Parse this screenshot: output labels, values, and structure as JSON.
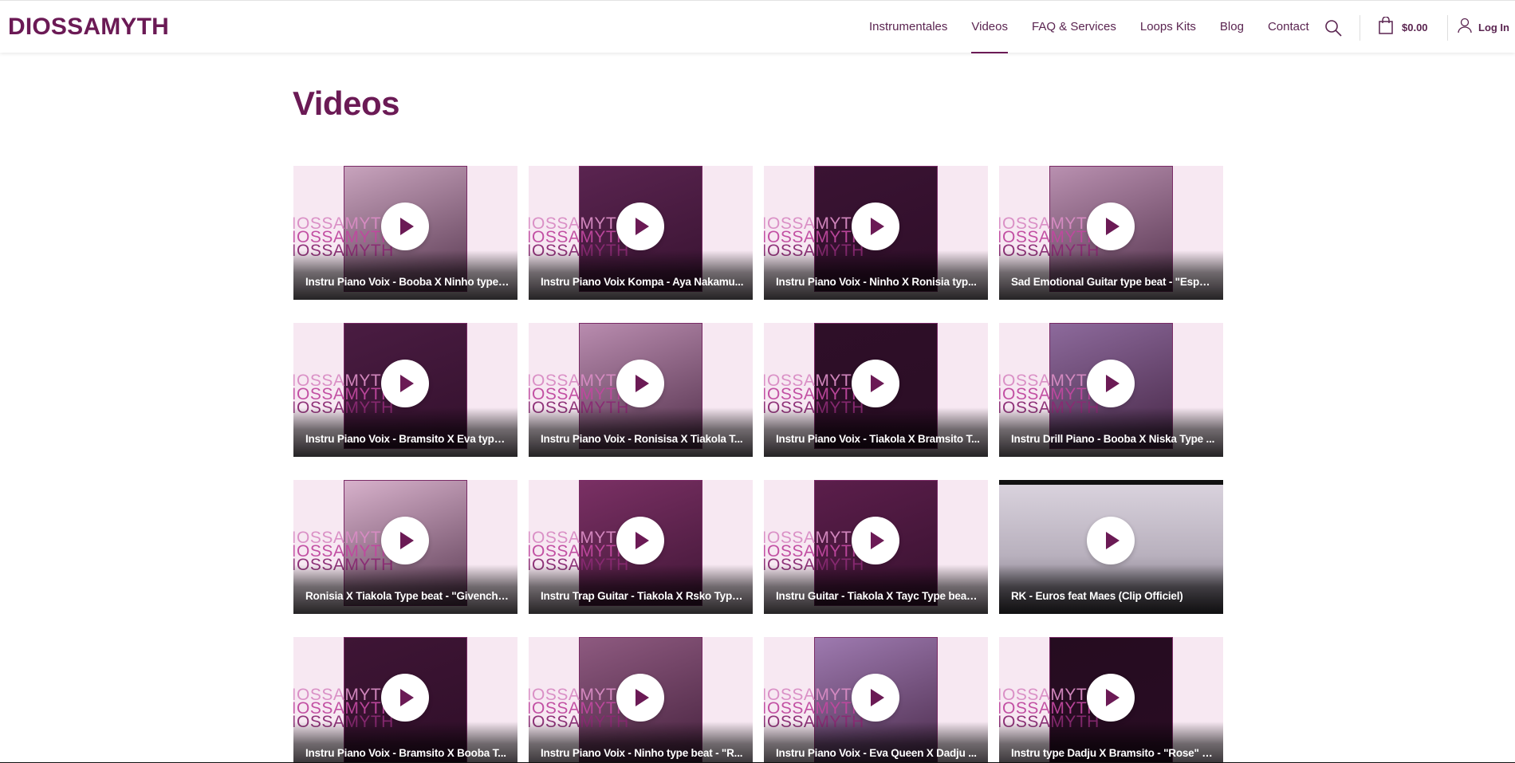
{
  "header": {
    "logo": "DIOSSAMYTH",
    "nav": [
      {
        "label": "Instrumentales",
        "active": false
      },
      {
        "label": "Videos",
        "active": true
      },
      {
        "label": "FAQ & Services",
        "active": false
      },
      {
        "label": "Loops Kits",
        "active": false
      },
      {
        "label": "Blog",
        "active": false
      },
      {
        "label": "Contact",
        "active": false
      }
    ],
    "cart_amount": "$0.00",
    "login_label": "Log In"
  },
  "page": {
    "title": "Videos"
  },
  "watermark": "DIOSSAMYTH",
  "colors": {
    "brand": "#6b1a55",
    "accent": "#5a2450",
    "overlay_text": "#ffffff"
  },
  "videos": [
    {
      "title": "Instru Piano Voix - Booba X Ninho type ...",
      "thumb": "#c8a3bd"
    },
    {
      "title": "Instru Piano Voix Kompa - Aya Nakamu...",
      "thumb": "#5a2450"
    },
    {
      "title": "Instru Piano Voix - Ninho X Ronisia typ...",
      "thumb": "#3a1333"
    },
    {
      "title": "Sad Emotional Guitar type beat - \"Espoi...",
      "thumb": "#b990b0"
    },
    {
      "title": "Instru Piano Voix - Bramsito X Eva type ...",
      "thumb": "#4a1c42"
    },
    {
      "title": "Instru Piano Voix - Ronisisa X Tiakola T...",
      "thumb": "#b98caf"
    },
    {
      "title": "Instru Piano Voix - Tiakola X Bramsito T...",
      "thumb": "#2e0f28"
    },
    {
      "title": "Instru Drill Piano - Booba X Niska Type ...",
      "thumb": "#8d6a9c"
    },
    {
      "title": "Ronisia X Tiakola Type beat - \"Givenchy...",
      "thumb": "#d7b1cb"
    },
    {
      "title": "Instru Trap Guitar - Tiakola X Rsko Type...",
      "thumb": "#7a3064"
    },
    {
      "title": "Instru Guitar - Tiakola X Tayc Type beat ...",
      "thumb": "#5b1e4b"
    },
    {
      "title": "RK - Euros feat Maes (Clip Officiel)",
      "thumb": "#c9c3cf"
    },
    {
      "title": "Instru Piano Voix - Bramsito X Booba T...",
      "thumb": "#3e1535"
    },
    {
      "title": "Instru Piano Voix - Ninho type beat - \"R...",
      "thumb": "#8e5a80"
    },
    {
      "title": "Instru Piano Voix - Eva Queen X Dadju ...",
      "thumb": "#9e7ab0"
    },
    {
      "title": "Instru type Dadju X Bramsito - \"Rose\" 2...",
      "thumb": "#250c20"
    }
  ]
}
